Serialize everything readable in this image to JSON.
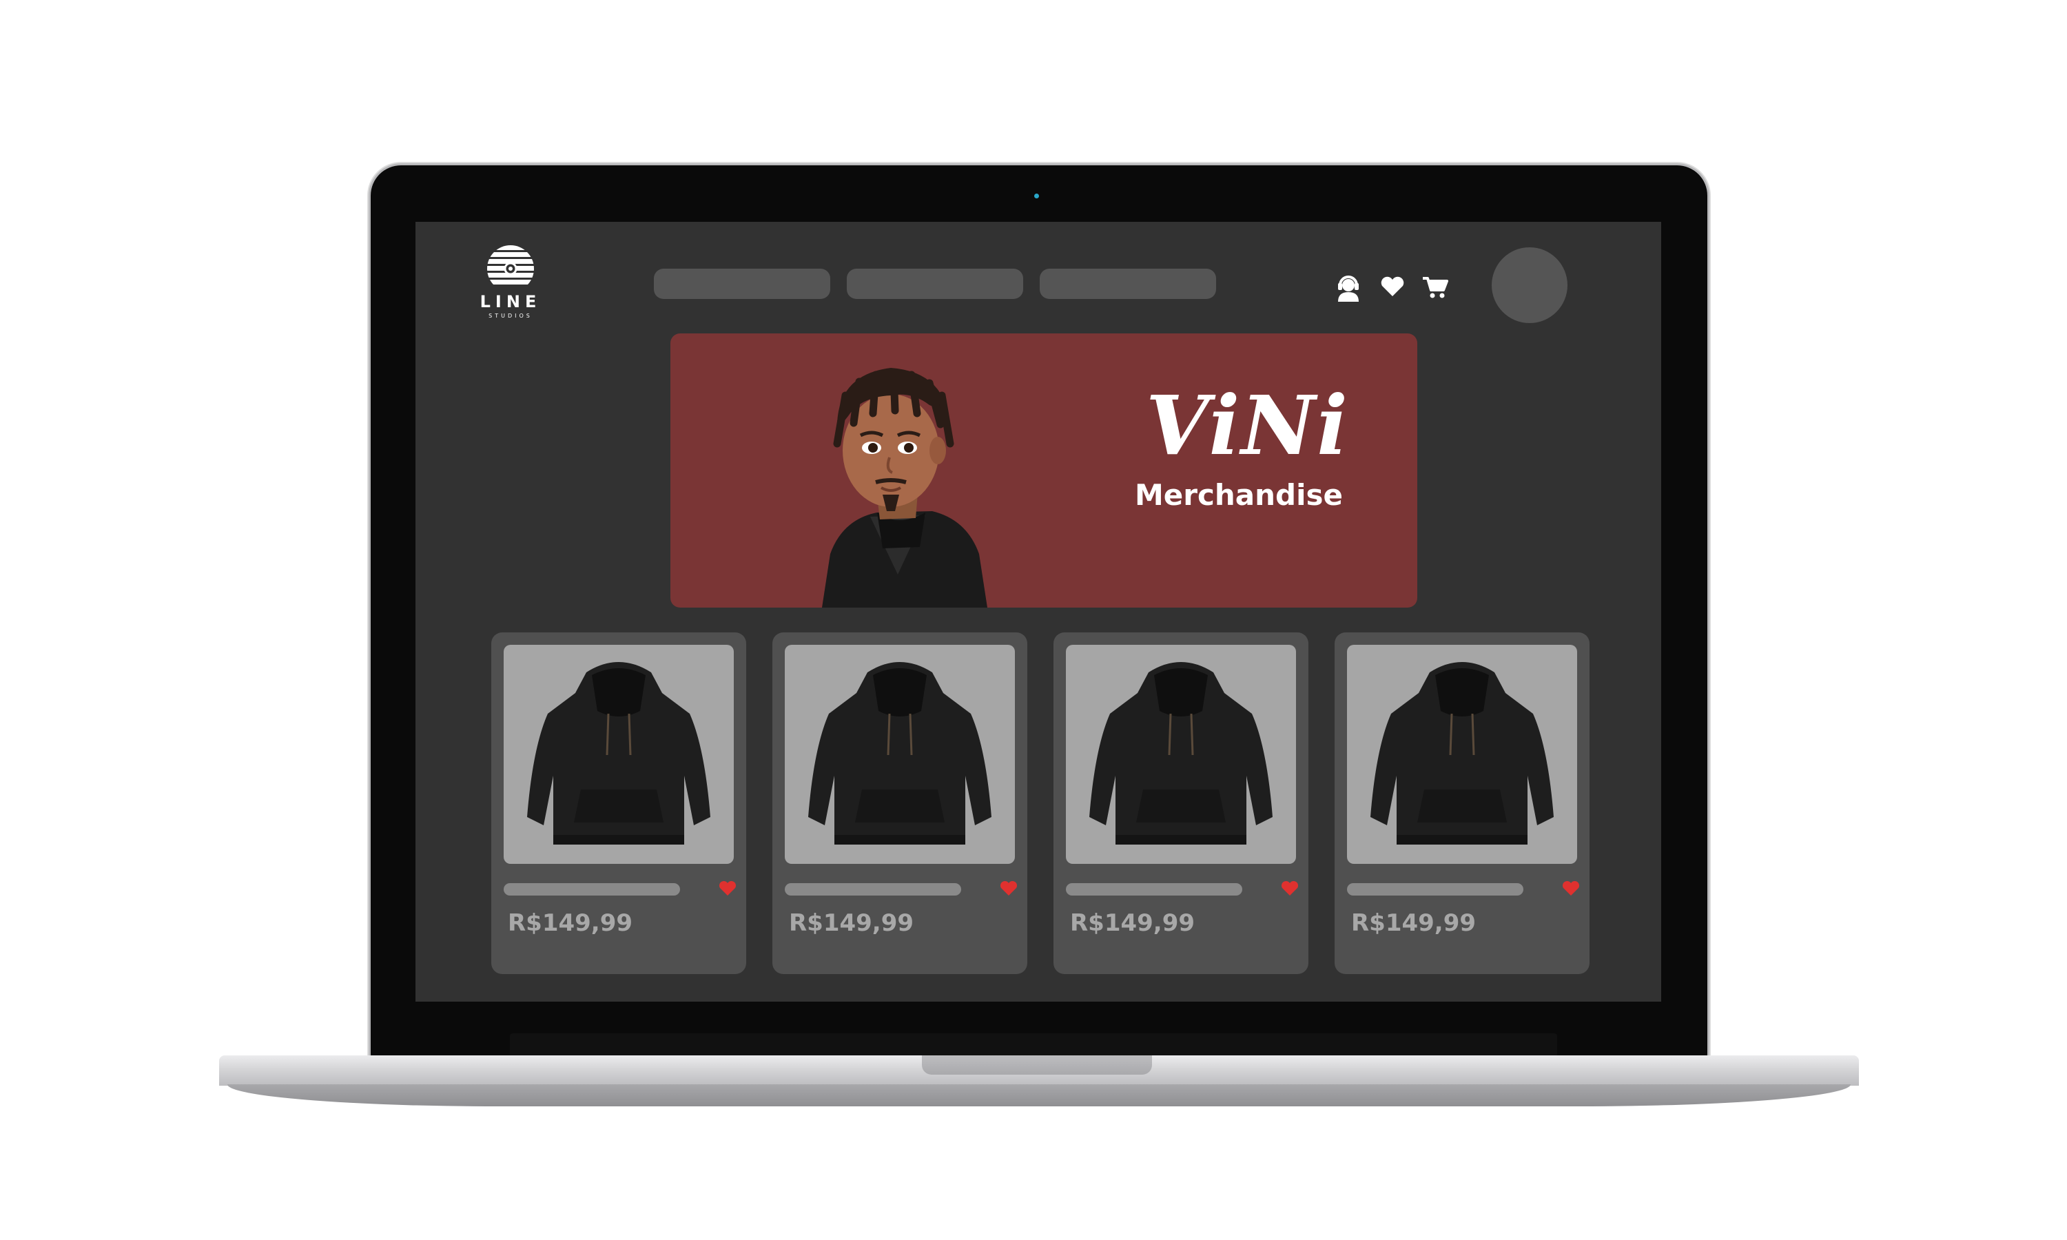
{
  "logo": {
    "word": "LINE",
    "sub": "STUDIOS"
  },
  "nav": {
    "items": [
      "",
      "",
      ""
    ]
  },
  "header_icons": [
    "support-agent-icon",
    "heart-icon",
    "cart-icon"
  ],
  "banner": {
    "title": "ViNi",
    "subtitle": "Merchandise",
    "background": "#7a3535"
  },
  "products": [
    {
      "price": "R$149,99",
      "favorite": true
    },
    {
      "price": "R$149,99",
      "favorite": true
    },
    {
      "price": "R$149,99",
      "favorite": true
    },
    {
      "price": "R$149,99",
      "favorite": true
    }
  ],
  "colors": {
    "page": "#323232",
    "placeholder": "#555555",
    "card": "#505050",
    "heart": "#e0312f"
  }
}
